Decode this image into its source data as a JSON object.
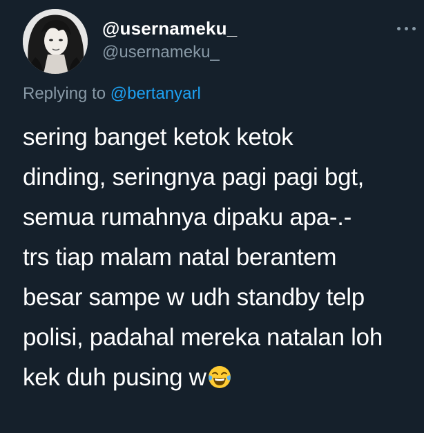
{
  "author": {
    "display_name": "@usernameku_",
    "handle": "@usernameku_"
  },
  "reply": {
    "prefix": "Replying to",
    "mention": "@bertanyarl"
  },
  "tweet": {
    "lines": [
      "sering banget ketok ketok",
      "dinding, seringnya pagi pagi bgt,",
      "semua rumahnya dipaku apa-.-",
      "trs tiap malam natal berantem",
      "besar sampe w udh standby telp",
      "polisi, padahal mereka natalan loh",
      "kek duh pusing w"
    ],
    "trailing_emoji_icon": "face-with-tears-of-joy-icon"
  },
  "icons": {
    "more": "more-dots-icon",
    "avatar": "profile-avatar"
  },
  "colors": {
    "background": "#15202b",
    "primary_text": "#ffffff",
    "secondary_text": "#8899a6",
    "link": "#1da1f2"
  }
}
